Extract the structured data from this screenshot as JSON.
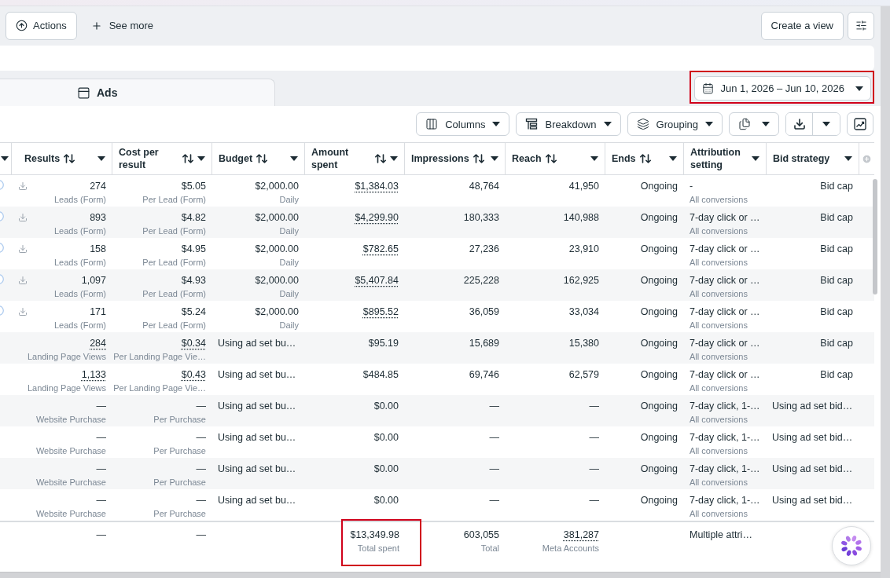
{
  "toolbar": {
    "actions": "Actions",
    "see_more": "See more",
    "create_view": "Create a view"
  },
  "tabs": [
    {
      "label": "Ads",
      "selected": true
    }
  ],
  "date_range": {
    "label": "Jun 1, 2026 – Jun 10, 2026",
    "highlighted": true
  },
  "table_toolbar": [
    {
      "kind": "columns",
      "label": "Columns"
    },
    {
      "kind": "breakdown",
      "label": "Breakdown"
    },
    {
      "kind": "grouping",
      "label": "Grouping"
    }
  ],
  "table": {
    "columns": [
      {
        "label": "Results",
        "sortable": true
      },
      {
        "label": "Cost per result",
        "sortable": true
      },
      {
        "label": "Budget",
        "sortable": true
      },
      {
        "label": "Amount spent",
        "sortable": true
      },
      {
        "label": "Impressions",
        "sortable": true
      },
      {
        "label": "Reach",
        "sortable": true
      },
      {
        "label": "Ends",
        "sortable": true
      },
      {
        "label": "Attribution setting",
        "sortable": false
      },
      {
        "label": "Bid strategy",
        "sortable": false
      }
    ],
    "rows": [
      {
        "radio": true,
        "download": true,
        "results": {
          "value": "274",
          "label": "Leads (Form)",
          "dotted": false
        },
        "cost_per_result": {
          "value": "$5.05",
          "label": "Per Lead (Form)",
          "dotted": false
        },
        "budget": {
          "kind": "value",
          "value": "$2,000.00",
          "label": "Daily"
        },
        "amount_spent": {
          "value": "$1,384.03",
          "dotted": true
        },
        "impressions": "48,764",
        "reach": "41,950",
        "ends": "Ongoing",
        "attribution": {
          "value": "-",
          "label": "All conversions"
        },
        "bid_strategy": {
          "kind": "value",
          "value": "Bid cap"
        }
      },
      {
        "radio": true,
        "download": true,
        "results": {
          "value": "893",
          "label": "Leads (Form)",
          "dotted": false
        },
        "cost_per_result": {
          "value": "$4.82",
          "label": "Per Lead (Form)",
          "dotted": false
        },
        "budget": {
          "kind": "value",
          "value": "$2,000.00",
          "label": "Daily"
        },
        "amount_spent": {
          "value": "$4,299.90",
          "dotted": true
        },
        "impressions": "180,333",
        "reach": "140,988",
        "ends": "Ongoing",
        "attribution": {
          "value": "7-day click or …",
          "label": "All conversions"
        },
        "bid_strategy": {
          "kind": "value",
          "value": "Bid cap"
        }
      },
      {
        "radio": true,
        "download": true,
        "results": {
          "value": "158",
          "label": "Leads (Form)",
          "dotted": false
        },
        "cost_per_result": {
          "value": "$4.95",
          "label": "Per Lead (Form)",
          "dotted": false
        },
        "budget": {
          "kind": "value",
          "value": "$2,000.00",
          "label": "Daily"
        },
        "amount_spent": {
          "value": "$782.65",
          "dotted": true
        },
        "impressions": "27,236",
        "reach": "23,910",
        "ends": "Ongoing",
        "attribution": {
          "value": "7-day click or …",
          "label": "All conversions"
        },
        "bid_strategy": {
          "kind": "value",
          "value": "Bid cap"
        }
      },
      {
        "radio": true,
        "download": true,
        "results": {
          "value": "1,097",
          "label": "Leads (Form)",
          "dotted": false
        },
        "cost_per_result": {
          "value": "$4.93",
          "label": "Per Lead (Form)",
          "dotted": false
        },
        "budget": {
          "kind": "value",
          "value": "$2,000.00",
          "label": "Daily"
        },
        "amount_spent": {
          "value": "$5,407.84",
          "dotted": true
        },
        "impressions": "225,228",
        "reach": "162,925",
        "ends": "Ongoing",
        "attribution": {
          "value": "7-day click or …",
          "label": "All conversions"
        },
        "bid_strategy": {
          "kind": "value",
          "value": "Bid cap"
        }
      },
      {
        "radio": true,
        "download": true,
        "results": {
          "value": "171",
          "label": "Leads (Form)",
          "dotted": false
        },
        "cost_per_result": {
          "value": "$5.24",
          "label": "Per Lead (Form)",
          "dotted": false
        },
        "budget": {
          "kind": "value",
          "value": "$2,000.00",
          "label": "Daily"
        },
        "amount_spent": {
          "value": "$895.52",
          "dotted": true
        },
        "impressions": "36,059",
        "reach": "33,034",
        "ends": "Ongoing",
        "attribution": {
          "value": "7-day click or …",
          "label": "All conversions"
        },
        "bid_strategy": {
          "kind": "value",
          "value": "Bid cap"
        }
      },
      {
        "radio": false,
        "download": false,
        "results": {
          "value": "284",
          "label": "Landing Page Views",
          "dotted": true
        },
        "cost_per_result": {
          "value": "$0.34",
          "label": "Per Landing Page Vie…",
          "dotted": true
        },
        "budget": {
          "kind": "inherited",
          "value": "Using ad set bu…"
        },
        "amount_spent": {
          "value": "$95.19",
          "dotted": false
        },
        "impressions": "15,689",
        "reach": "15,380",
        "ends": "Ongoing",
        "attribution": {
          "value": "7-day click or …",
          "label": "All conversions"
        },
        "bid_strategy": {
          "kind": "value",
          "value": "Bid cap"
        }
      },
      {
        "radio": false,
        "download": false,
        "results": {
          "value": "1,133",
          "label": "Landing Page Views",
          "dotted": true
        },
        "cost_per_result": {
          "value": "$0.43",
          "label": "Per Landing Page Vie…",
          "dotted": true
        },
        "budget": {
          "kind": "inherited",
          "value": "Using ad set bu…"
        },
        "amount_spent": {
          "value": "$484.85",
          "dotted": false
        },
        "impressions": "69,746",
        "reach": "62,579",
        "ends": "Ongoing",
        "attribution": {
          "value": "7-day click or …",
          "label": "All conversions"
        },
        "bid_strategy": {
          "kind": "value",
          "value": "Bid cap"
        }
      },
      {
        "radio": false,
        "download": false,
        "results": {
          "value": "—",
          "label": "Website Purchase",
          "dotted": false
        },
        "cost_per_result": {
          "value": "—",
          "label": "Per Purchase",
          "dotted": false
        },
        "budget": {
          "kind": "inherited",
          "value": "Using ad set bu…"
        },
        "amount_spent": {
          "value": "$0.00",
          "dotted": false
        },
        "impressions": "—",
        "reach": "—",
        "ends": "Ongoing",
        "attribution": {
          "value": "7-day click, 1-…",
          "label": "All conversions"
        },
        "bid_strategy": {
          "kind": "inherited",
          "value": "Using ad set bid…"
        }
      },
      {
        "radio": false,
        "download": false,
        "results": {
          "value": "—",
          "label": "Website Purchase",
          "dotted": false
        },
        "cost_per_result": {
          "value": "—",
          "label": "Per Purchase",
          "dotted": false
        },
        "budget": {
          "kind": "inherited",
          "value": "Using ad set bu…"
        },
        "amount_spent": {
          "value": "$0.00",
          "dotted": false
        },
        "impressions": "—",
        "reach": "—",
        "ends": "Ongoing",
        "attribution": {
          "value": "7-day click, 1-…",
          "label": "All conversions"
        },
        "bid_strategy": {
          "kind": "inherited",
          "value": "Using ad set bid…"
        }
      },
      {
        "radio": false,
        "download": false,
        "results": {
          "value": "—",
          "label": "Website Purchase",
          "dotted": false
        },
        "cost_per_result": {
          "value": "—",
          "label": "Per Purchase",
          "dotted": false
        },
        "budget": {
          "kind": "inherited",
          "value": "Using ad set bu…"
        },
        "amount_spent": {
          "value": "$0.00",
          "dotted": false
        },
        "impressions": "—",
        "reach": "—",
        "ends": "Ongoing",
        "attribution": {
          "value": "7-day click, 1-…",
          "label": "All conversions"
        },
        "bid_strategy": {
          "kind": "inherited",
          "value": "Using ad set bid…"
        }
      },
      {
        "radio": false,
        "download": false,
        "results": {
          "value": "—",
          "label": "Website Purchase",
          "dotted": false
        },
        "cost_per_result": {
          "value": "—",
          "label": "Per Purchase",
          "dotted": false
        },
        "budget": {
          "kind": "inherited",
          "value": "Using ad set bu…"
        },
        "amount_spent": {
          "value": "$0.00",
          "dotted": false
        },
        "impressions": "—",
        "reach": "—",
        "ends": "Ongoing",
        "attribution": {
          "value": "7-day click, 1-…",
          "label": "All conversions"
        },
        "bid_strategy": {
          "kind": "inherited",
          "value": "Using ad set bid…"
        }
      }
    ],
    "totals": {
      "results": "—",
      "cost_per_result": "—",
      "amount_spent": {
        "value": "$13,349.98",
        "label": "Total spent",
        "highlighted": true
      },
      "impressions": {
        "value": "603,055",
        "label": "Total",
        "dotted": false
      },
      "reach": {
        "value": "381,287",
        "label": "Meta Accounts",
        "dotted": true
      },
      "attribution": "Multiple attri…"
    }
  }
}
